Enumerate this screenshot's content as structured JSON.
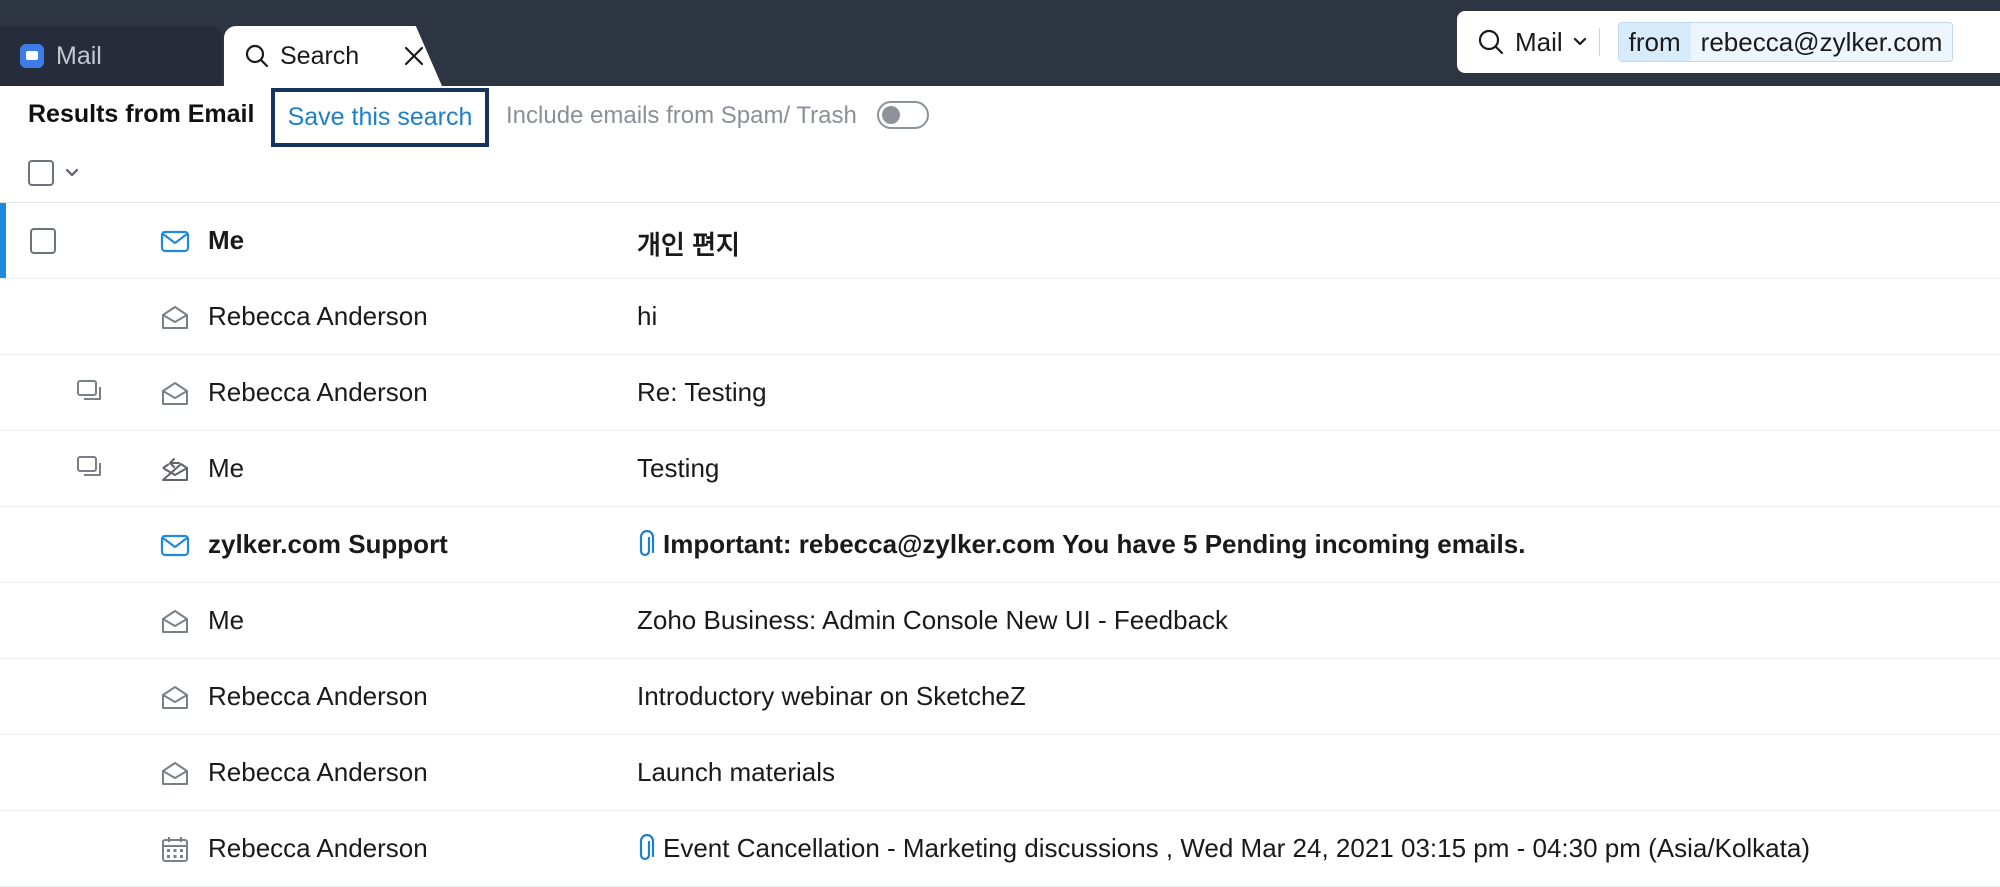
{
  "tabs": {
    "mail_label": "Mail",
    "search_label": "Search"
  },
  "search": {
    "scope_label": "Mail",
    "filter_key": "from",
    "filter_value": "rebecca@zylker.com"
  },
  "toolbar": {
    "results_title": "Results from Email",
    "save_search_label": "Save this search",
    "include_spam_label": "Include emails from Spam/ Trash",
    "include_spam_on": false
  },
  "emails": [
    {
      "sender": "Me",
      "subject": "개인 편지",
      "unread": true,
      "selected": true,
      "thread": false,
      "attachment": false,
      "icon": "envelope-unread-icon"
    },
    {
      "sender": "Rebecca Anderson",
      "subject": "hi",
      "unread": false,
      "selected": false,
      "thread": false,
      "attachment": false,
      "icon": "envelope-open-icon"
    },
    {
      "sender": "Rebecca Anderson",
      "subject": "Re: Testing",
      "unread": false,
      "selected": false,
      "thread": true,
      "attachment": false,
      "icon": "envelope-open-icon"
    },
    {
      "sender": "Me",
      "subject": "Testing",
      "unread": false,
      "selected": false,
      "thread": true,
      "attachment": false,
      "icon": "envelope-replied-icon"
    },
    {
      "sender": "zylker.com Support",
      "subject": "Important: rebecca@zylker.com You have 5 Pending incoming emails.",
      "unread": true,
      "selected": false,
      "thread": false,
      "attachment": true,
      "icon": "envelope-unread-icon"
    },
    {
      "sender": "Me",
      "subject": "Zoho Business: Admin Console New UI - Feedback",
      "unread": false,
      "selected": false,
      "thread": false,
      "attachment": false,
      "icon": "envelope-open-icon"
    },
    {
      "sender": "Rebecca Anderson",
      "subject": "Introductory webinar on SketcheZ",
      "unread": false,
      "selected": false,
      "thread": false,
      "attachment": false,
      "icon": "envelope-open-icon"
    },
    {
      "sender": "Rebecca Anderson",
      "subject": "Launch materials",
      "unread": false,
      "selected": false,
      "thread": false,
      "attachment": false,
      "icon": "envelope-open-icon"
    },
    {
      "sender": "Rebecca Anderson",
      "subject": "Event Cancellation - Marketing discussions , Wed Mar 24, 2021 03:15 pm - 04:30 pm (Asia/Kolkata)",
      "unread": false,
      "selected": false,
      "thread": false,
      "attachment": true,
      "icon": "calendar-icon"
    }
  ],
  "colors": {
    "topbar": "#2d3442",
    "accent_blue": "#1f80c8",
    "unread_icon": "#1f8ae0",
    "save_border": "#16335e"
  }
}
